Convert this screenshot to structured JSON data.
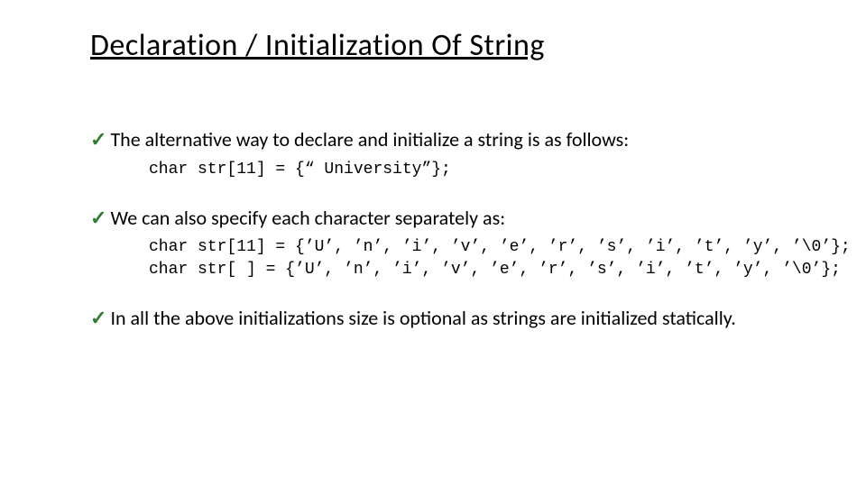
{
  "title": "Declaration / Initialization Of String",
  "bullets": {
    "b1": "The alternative way to declare and initialize a string is as follows:",
    "b2": "We can also specify each character separately as:",
    "b3": "In all the above initializations size is optional as strings are initialized statically."
  },
  "code": {
    "c1": "char str[11] = {“ University”};",
    "c2a": "char str[11] = {’U’, ’n’, ’i’, ’v’, ’e’, ’r’, ’s’, ’i’, ’t’, ’y’, ’\\0’};",
    "c2b": "char str[ ] = {’U’, ’n’, ’i’, ’v’, ’e’, ’r’, ’s’, ’i’, ’t’, ’y’, ’\\0’};"
  }
}
